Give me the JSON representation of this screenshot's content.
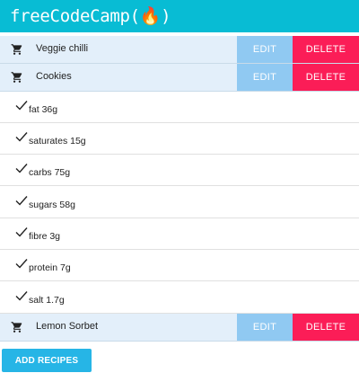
{
  "header": {
    "brand": "freeCodeCamp(🔥)"
  },
  "recipes": [
    {
      "name": "Veggie chilli",
      "edit_label": "EDIT",
      "delete_label": "DELETE"
    },
    {
      "name": "Cookies",
      "edit_label": "EDIT",
      "delete_label": "DELETE"
    },
    {
      "name": "Lemon Sorbet",
      "edit_label": "EDIT",
      "delete_label": "DELETE"
    }
  ],
  "ingredients": [
    "fat 36g",
    "saturates 15g",
    "carbs 75g",
    "sugars 58g",
    "fibre 3g",
    "protein 7g",
    "salt 1.7g"
  ],
  "footer": {
    "add_label": "ADD RECIPES"
  },
  "colors": {
    "topbar": "#08bcd4",
    "edit": "#90c9f2",
    "delete": "#fb1d57",
    "add": "#26b5e6",
    "row": "#e3effa"
  },
  "icons": {
    "recipe": "shopping-cart-icon",
    "ingredient": "check-icon"
  }
}
